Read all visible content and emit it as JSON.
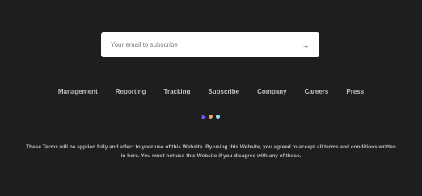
{
  "subscribe": {
    "placeholder": "Your email to subscribe",
    "submit_icon": "arrow-right-icon",
    "submit_glyph": "→"
  },
  "nav": {
    "items": [
      {
        "label": "Management"
      },
      {
        "label": "Reporting"
      },
      {
        "label": "Tracking"
      },
      {
        "label": "Subscribe"
      },
      {
        "label": "Company"
      },
      {
        "label": "Careers"
      },
      {
        "label": "Press"
      }
    ]
  },
  "decor": {
    "colors": {
      "triangle": "#7b5cff",
      "dot_orange": "#f2a65a",
      "dot_cyan": "#8fe3ff"
    }
  },
  "legal": {
    "text": "These Terms will be applied fully and affect to your use of this Website. By using this Website, you agreed to accept all terms and conditions written in here. You must not use this Website if you disagree with any of these."
  }
}
